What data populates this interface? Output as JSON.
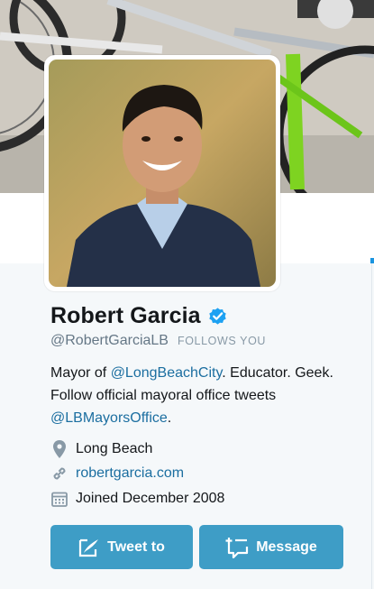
{
  "profile": {
    "name": "Robert Garcia",
    "handle": "@RobertGarciaLB",
    "follows_badge": "FOLLOWS YOU",
    "verified": true,
    "bio": {
      "part1": "Mayor of ",
      "mention1": "@LongBeachCity",
      "part2": ". Educator. Geek. Follow official mayoral office tweets ",
      "mention2": "@LBMayorsOffice",
      "part3": "."
    },
    "location": "Long Beach",
    "website": "robertgarcia.com",
    "joined": "Joined December 2008"
  },
  "actions": {
    "tweet_to": "Tweet to",
    "message": "Message"
  },
  "icons": {
    "verified": "verified-badge-icon",
    "location": "map-pin-icon",
    "website": "link-icon",
    "joined": "calendar-icon",
    "tweet_to": "compose-icon",
    "message": "new-message-icon"
  },
  "colors": {
    "accent_link": "#1b6ea0",
    "button": "#3e9dc6",
    "verified": "#1da1f2",
    "page_bg": "#f5f8fa"
  }
}
